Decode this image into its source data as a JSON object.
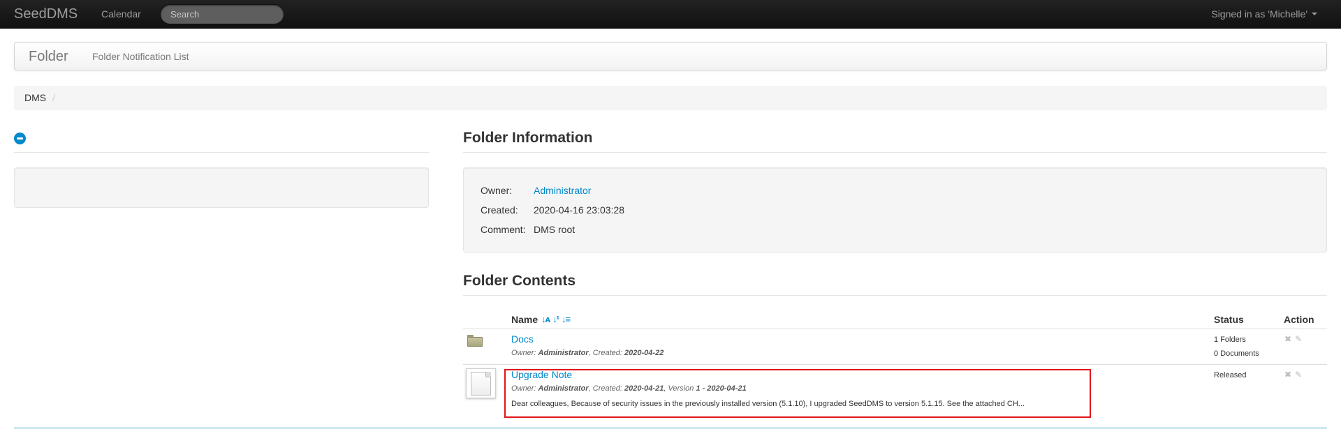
{
  "navbar": {
    "brand": "SeedDMS",
    "calendar": "Calendar",
    "search_placeholder": "Search",
    "user": "Signed in as 'Michelle'"
  },
  "pagebar": {
    "title": "Folder",
    "notification_link": "Folder Notification List"
  },
  "breadcrumb": {
    "items": [
      "DMS"
    ],
    "divider": "/"
  },
  "folder_info": {
    "title": "Folder Information",
    "owner_label": "Owner:",
    "owner": "Administrator",
    "created_label": "Created:",
    "created": "2020-04-16 23:03:28",
    "comment_label": "Comment:",
    "comment": "DMS root"
  },
  "folder_contents": {
    "title": "Folder Contents",
    "columns": {
      "name": "Name",
      "status": "Status",
      "action": "Action"
    },
    "sort_icons": [
      "sort-alpha-icon",
      "sort-numeric-icon",
      "sort-amount-icon"
    ],
    "rows": [
      {
        "name": "Docs",
        "owner_label": "Owner:",
        "owner": "Administrator",
        "created_label": "Created:",
        "created": "2020-04-22",
        "status_line1": "1 Folders",
        "status_line2": "0 Documents"
      },
      {
        "name": "Upgrade Note",
        "owner_label": "Owner:",
        "owner": "Administrator",
        "created_label": "Created:",
        "created": "2020-04-21",
        "version_label": "Version",
        "version": "1 - 2020-04-21",
        "comment": "Dear colleagues, Because of security issues in the previously installed version (5.1.10), I upgraded SeedDMS to version 5.1.15. See the attached CH...",
        "status": "Released"
      }
    ]
  },
  "colors": {
    "link": "#0088cc",
    "highlight": "#e0151a",
    "navbar": "#1b1b1b"
  }
}
